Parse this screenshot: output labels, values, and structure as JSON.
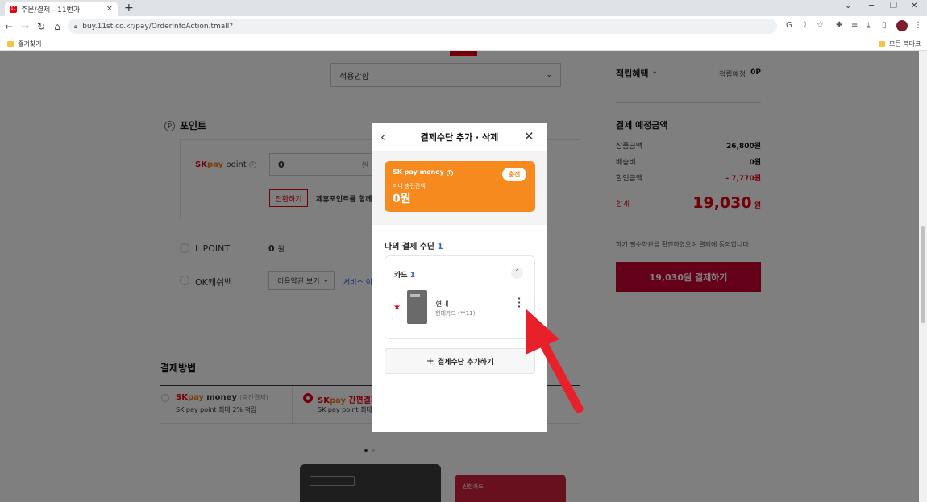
{
  "browser": {
    "tab_title": "주문/결제 - 11번가",
    "tab_favicon": "11",
    "url": "buy.11st.co.kr/pay/OrderInfoAction.tmall?",
    "bookmark_left": "즐겨찾기",
    "bookmark_right": "모든 북마크"
  },
  "page": {
    "select_value": "적용안함",
    "points_title": "포인트",
    "points_icon": "P",
    "skpay_point_label": "point",
    "skpay_input_value": "0",
    "skpay_unit": "원",
    "convert_button": "전환하기",
    "affiliate_text": "제휴포인트를 함께 사",
    "lpoint_label": "L.POINT",
    "lpoint_value": "0",
    "lpoint_unit": "원",
    "okcash_label": "OK캐쉬백",
    "okcash_select": "이용약관 보기",
    "okcash_link": "서비스 이",
    "payment_method_title": "결제방법",
    "method1_sub": "(충전결제)",
    "method1_desc": "SK pay point 최대 2% 적립",
    "method2_name": "간편결제",
    "method2_desc": "SK pay point 최대 2",
    "card2_text": "신한카드"
  },
  "summary": {
    "reward_title": "적립혜택",
    "reward_expected_label": "적립예정",
    "reward_expected_value": "0P",
    "payment_title": "결제 예정금액",
    "product_label": "상품금액",
    "product_value": "26,800원",
    "shipping_label": "배송비",
    "shipping_value": "0원",
    "discount_label": "할인금액",
    "discount_value": "- 7,770원",
    "total_label": "합계",
    "total_value": "19,030",
    "total_unit": "원",
    "agree_text": "하기 필수약관을 확인하였으며 결제에 동의합니다.",
    "pay_button": "19,030원 결제하기"
  },
  "modal": {
    "title": "결제수단 추가 · 삭제",
    "money_brand": "SK pay money",
    "money_info": "i",
    "charge_button": "충전",
    "balance_label": "머니 충전잔액",
    "balance_value": "0원",
    "my_methods_title": "나의 결제 수단",
    "my_methods_count": "1",
    "card_section_title": "카드",
    "card_section_count": "1",
    "card_name": "현대",
    "card_sub": "현대카드 (**11)",
    "add_method_button": "결제수단 추가하기"
  },
  "colors": {
    "brand_red": "#e60012",
    "pay_button": "#c8002f",
    "money_orange": "#f68a1f",
    "arrow_red": "#e8202a"
  }
}
